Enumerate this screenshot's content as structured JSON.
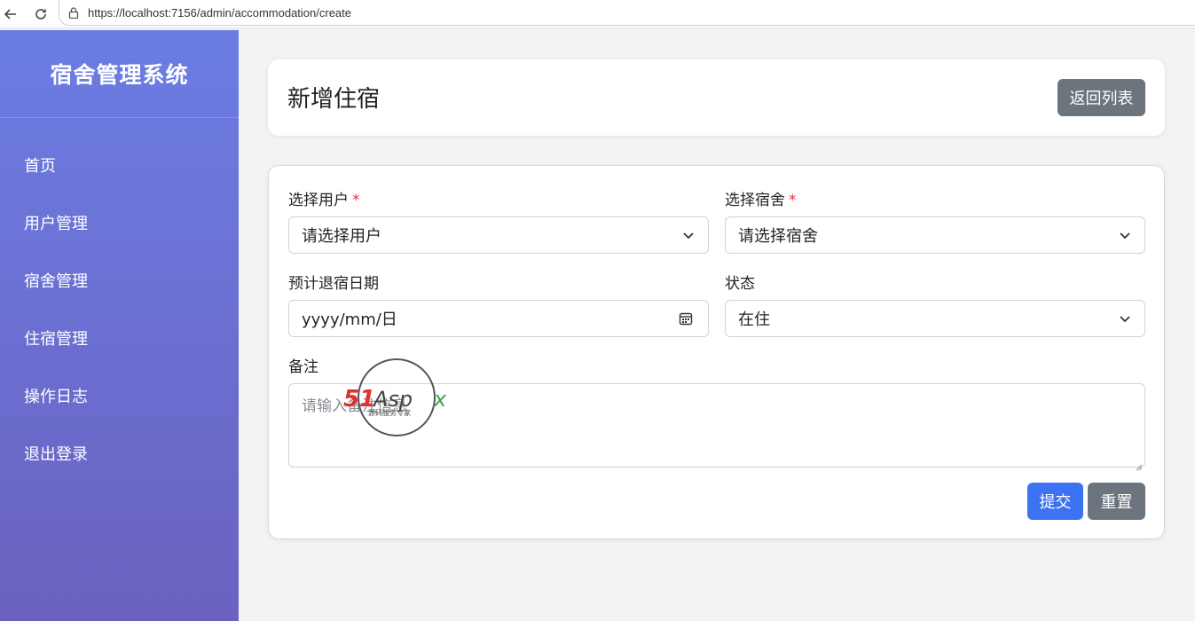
{
  "browser": {
    "url": "https://localhost:7156/admin/accommodation/create"
  },
  "sidebar": {
    "brand": "宿舍管理系统",
    "items": [
      {
        "label": "首页"
      },
      {
        "label": "用户管理"
      },
      {
        "label": "宿舍管理"
      },
      {
        "label": "住宿管理"
      },
      {
        "label": "操作日志"
      },
      {
        "label": "退出登录"
      }
    ]
  },
  "header": {
    "title": "新增住宿",
    "back_label": "返回列表"
  },
  "form": {
    "user": {
      "label": "选择用户",
      "required_mark": "*",
      "value": "请选择用户"
    },
    "dorm": {
      "label": "选择宿舍",
      "required_mark": "*",
      "value": "请选择宿舍"
    },
    "checkout_date": {
      "label": "预计退宿日期",
      "value": "yyyy/mm/日"
    },
    "status": {
      "label": "状态",
      "value": "在住"
    },
    "remark": {
      "label": "备注",
      "placeholder": "请输入备注信息"
    },
    "submit_label": "提交",
    "reset_label": "重置"
  },
  "watermark": {
    "brand": "51Aspx",
    "tagline": "源码服务专家"
  },
  "colors": {
    "sidebar_top": "#6b7de3",
    "sidebar_bottom": "#6b62c0",
    "primary": "#3b73f3",
    "secondary": "#6c757d",
    "required": "#dc3545"
  }
}
